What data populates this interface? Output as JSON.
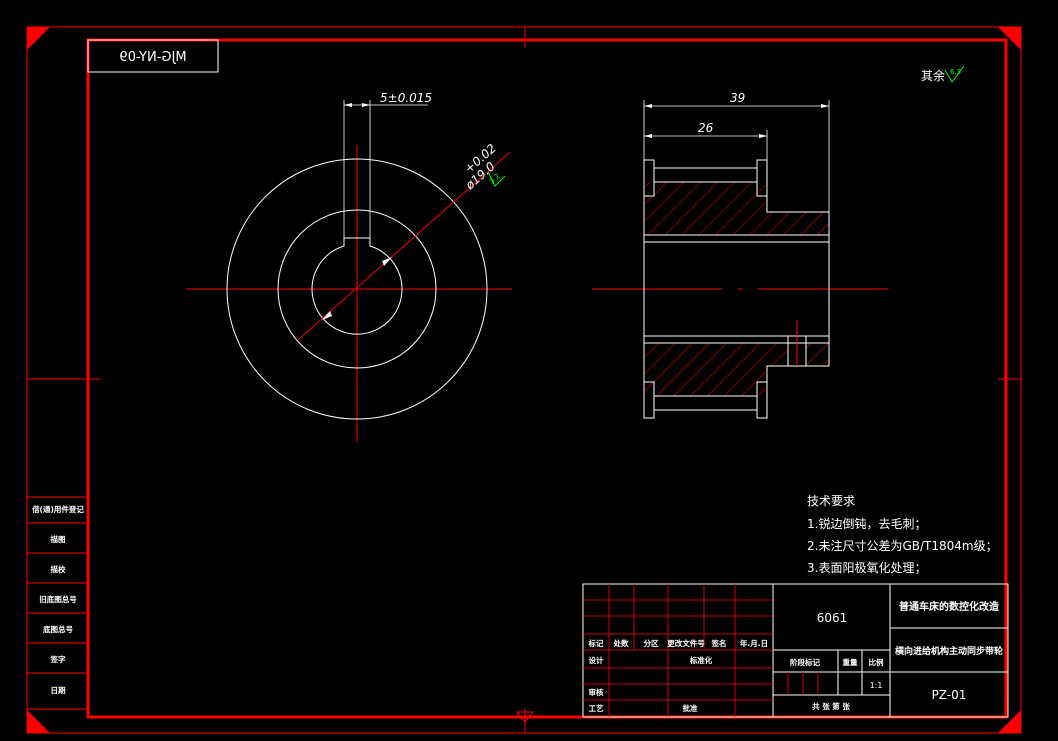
{
  "drawing_number_mirrored": "MJG-NY-09",
  "surface_note": "其余",
  "surface_note_value": "6.3",
  "dimensions": {
    "keyway_width": "5±0.015",
    "bore_upper_tol": "+0.02",
    "bore_diameter": "ø19.0",
    "bore_roughness": "3.2",
    "total_length": "39",
    "hub_length": "26"
  },
  "technical_requirements": {
    "title": "技术要求",
    "items": [
      "1.锐边倒钝，去毛刺；",
      "2.未注尺寸公差为GB/T1804m级；",
      "3.表面阳极氧化处理；"
    ]
  },
  "title_block": {
    "material": "6061",
    "project_title": "普通车床的数控化改造",
    "part_name": "横向进给机构主动同步带轮",
    "drawing_code": "PZ-01",
    "scale": "1:1",
    "header_labels": [
      "标记",
      "处数",
      "分区",
      "更改文件号",
      "签名",
      "年.月.日"
    ],
    "row_design": "设计",
    "row_standardize": "标准化",
    "row_stage_mark": "阶段标记",
    "row_weight": "重量",
    "row_scale": "比例",
    "row_review": "审核",
    "row_process": "工艺",
    "row_approve": "批准",
    "row_sheets": "共  张 第  张"
  },
  "side_strip_labels": [
    "借(通)用件登记",
    "描图",
    "描校",
    "旧底图总号",
    "底图总号",
    "签字",
    "日期"
  ]
}
